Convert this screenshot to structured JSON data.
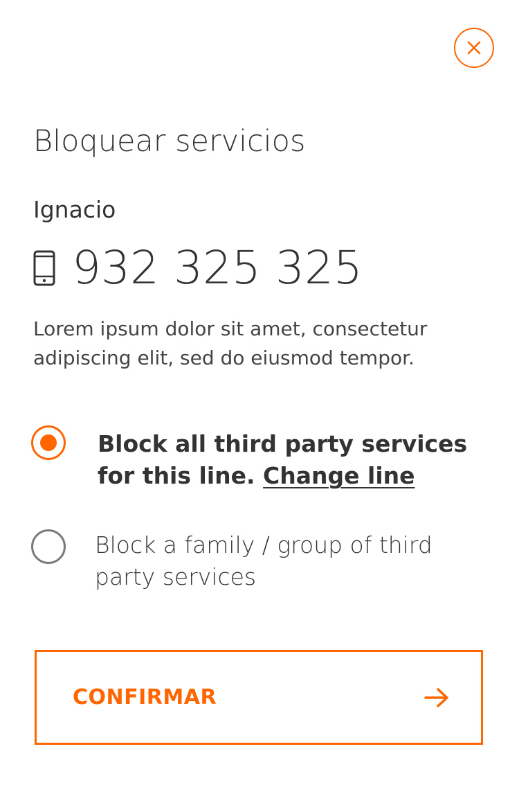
{
  "header": {
    "close_icon": "close-icon",
    "title": "Bloquear servicios"
  },
  "line": {
    "owner_name": "Ignacio",
    "device_icon": "mobile-phone-icon",
    "phone_number": "932 325 325"
  },
  "description": "Lorem ipsum dolor sit amet, consectetur adipiscing elit, sed do eiusmod tempor.",
  "options": [
    {
      "label": "Block all third party services for this line.",
      "link_label": "Change line",
      "selected": true
    },
    {
      "label": "Block a family / group of third party services",
      "selected": false
    }
  ],
  "confirm": {
    "label": "CONFIRMAR",
    "icon": "arrow-right-icon"
  },
  "colors": {
    "accent": "#ff6600",
    "text": "#333333",
    "radio_unchecked": "#7a7a7a"
  }
}
